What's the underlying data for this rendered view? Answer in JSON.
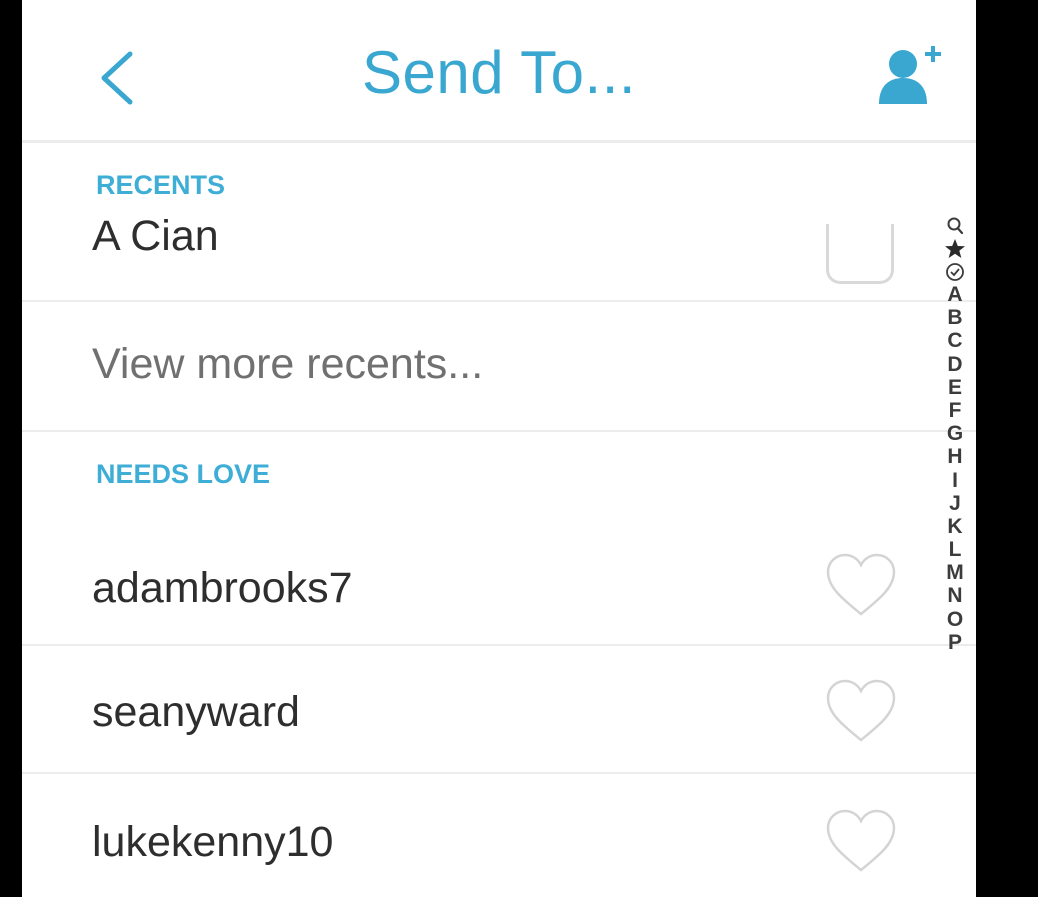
{
  "header": {
    "title": "Send To...",
    "back_icon": "chevron-left-icon",
    "add_friend_icon": "add-friend-icon"
  },
  "sections": {
    "recents": "RECENTS",
    "needs_love": "NEEDS LOVE"
  },
  "recents": [
    {
      "name": "A Cian"
    }
  ],
  "view_more": "View more recents...",
  "needs_love": [
    {
      "name": "adambrooks7"
    },
    {
      "name": "seanyward"
    },
    {
      "name": "lukekenny10"
    }
  ],
  "index": {
    "icons": [
      "search-icon",
      "star-icon",
      "check-circle-icon"
    ],
    "letters": [
      "A",
      "B",
      "C",
      "D",
      "E",
      "F",
      "G",
      "H",
      "I",
      "J",
      "K",
      "L",
      "M",
      "N",
      "O",
      "P"
    ]
  },
  "colors": {
    "accent": "#3aa7d1",
    "section": "#3eaed6",
    "text": "#2e2e2e",
    "divider": "#ececec"
  }
}
